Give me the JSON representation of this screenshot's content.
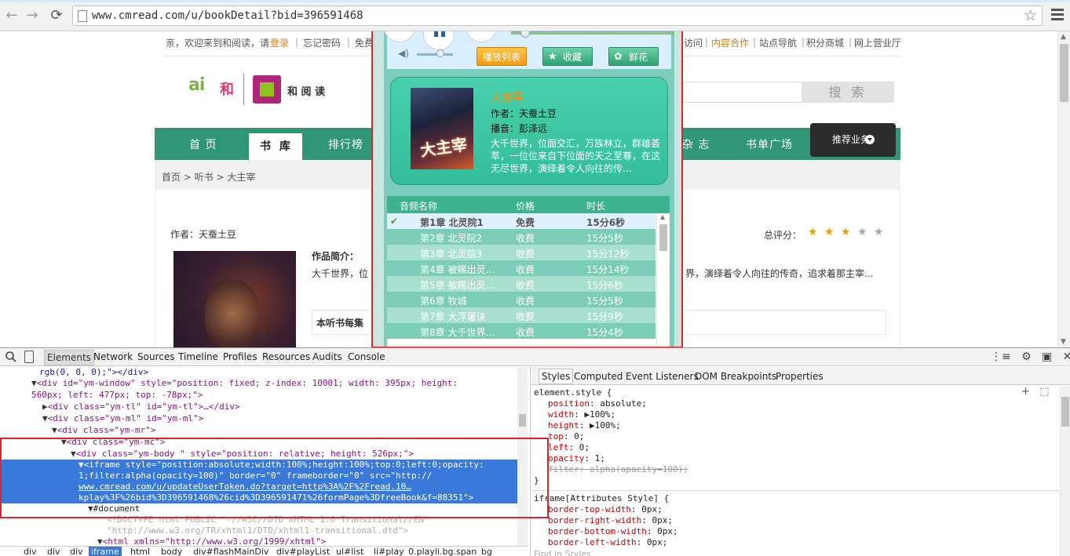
{
  "browser": {
    "url": "www.cmread.com/u/bookDetail?bid=396591468"
  },
  "site": {
    "topbar_links": [
      "亲，欢迎来到和阅读，请",
      "登录",
      "｜",
      "忘记密码",
      "｜",
      "免费",
      "访问",
      "｜",
      "内容合作",
      "｜",
      "站点导航",
      "｜",
      "积分商城",
      "｜",
      "网上营业厅"
    ],
    "logo_ai": "ai",
    "logo_he": "和",
    "logo_text": "和 阅 读",
    "search_label": "搜 索",
    "nav_items": [
      "首 页",
      "书 库",
      "排行榜",
      "杂 志",
      "书单广场"
    ],
    "promo_label": "推荐业务",
    "breadcrumb": "首页 >  听书 >  大主宰",
    "author_line": "作者：天蚕土豆",
    "rating_label": "总评分：",
    "intro_title": "作品简介：",
    "intro_text_left": "大千世界，位",
    "intro_text_right": "界，演绎着令人向往的传奇，追求着那主宰...",
    "chapter_box_label": "本听书每集"
  },
  "player": {
    "playlist_label": "播放列表",
    "favorite_label": "收藏",
    "flower_label": "鲜花",
    "book_title": "大主宰",
    "book_author": "作者：天蚕土豆",
    "book_narrator": "播音：彭泽远",
    "book_desc": "大千世界，位面交汇，万族林立，群雄荟萃，一位位来自下位面的天之至尊，在这无尽世界，演绎着令人向往的传...",
    "cover_title": "大主宰",
    "columns": [
      "音频名称",
      "价格",
      "时长"
    ],
    "rows": [
      {
        "name": "第1章  北灵院1",
        "price": "免费",
        "duration": "15分6秒"
      },
      {
        "name": "第2章  北灵院2",
        "price": "收费",
        "duration": "15分5秒"
      },
      {
        "name": "第3章  北灵院3",
        "price": "收费",
        "duration": "15分12秒"
      },
      {
        "name": "第4章  被赐出灵…",
        "price": "收费",
        "duration": "15分14秒"
      },
      {
        "name": "第5章  被赐出灵…",
        "price": "收费",
        "duration": "15分6秒"
      },
      {
        "name": "第6章  牧城",
        "price": "收费",
        "duration": "15分5秒"
      },
      {
        "name": "第7章  大浮屠诀",
        "price": "收费",
        "duration": "15分9秒"
      },
      {
        "name": "第8章  大千世界…",
        "price": "收费",
        "duration": "15分4秒"
      }
    ]
  },
  "devtools": {
    "tabs": [
      "Elements",
      "Network",
      "Sources",
      "Timeline",
      "Profiles",
      "Resources",
      "Audits",
      "Console"
    ],
    "style_tabs": [
      "Styles",
      "Computed",
      "Event Listeners",
      "DOM Breakpoints",
      "Properties"
    ],
    "breadcrumbs": [
      "div",
      "div",
      "div",
      "iframe",
      "html",
      "body",
      "div#flashMainDiv",
      "div#playList",
      "ul#list",
      "li#play_0.playli.bg.span_bg"
    ],
    "find_placeholder": "Find in Styles",
    "element_style_header": "element.style {",
    "element_style": [
      {
        "prop": "position",
        "value": "absolute;"
      },
      {
        "prop": "width",
        "value": "▶100%;"
      },
      {
        "prop": "height",
        "value": "▶100%;"
      },
      {
        "prop": "top",
        "value": "0;"
      },
      {
        "prop": "left",
        "value": "0;"
      },
      {
        "prop": "opacity",
        "value": "1;"
      },
      {
        "prop": "filter",
        "value": "alpha(opacity=100);"
      }
    ],
    "close_brace": "}",
    "attr_style_header": "iframe[Attributes Style] {",
    "attr_style": [
      {
        "prop": "border-top-width",
        "value": "0px;"
      },
      {
        "prop": "border-right-width",
        "value": "0px;"
      },
      {
        "prop": "border-bottom-width",
        "value": "0px;"
      },
      {
        "prop": "border-left-width",
        "value": "0px;"
      }
    ],
    "dom_lines": [
      "rgb(0, 0, 0);\"></div>",
      "<div id=\"ym-window\" style=\"position: fixed; z-index: 10001; width: 395px; height:",
      "560px; left: 477px; top: -78px;\">",
      "<div class=\"ym-tl\" id=\"ym-tl\">…</div>",
      "<div class=\"ym-ml\" id=\"ym-ml\">",
      "<div class=\"ym-mr\">",
      "<div class=\"ym-mc\">",
      "<div class=\"ym-body \" style=\"position: relative; height: 526px;\">",
      "<iframe style=\"position:absolute;width:100%;height:100%;top:0;left:0;opacity:",
      "1;filter:alpha(opacity=100)\" border=\"0\" frameborder=\"0\" src=\"http://",
      "www.cmread.com/u/updateUserToken.do?target=http%3A%2F%2Fread.10…",
      "kplay%3F%26bid%3D396591468%26cid%3D396591471%26formPage%3DfreeBook&f=88351\">",
      "#document",
      "<!DOCTYPE html PUBLIC \"-//W3C//DTD XHTML 1.0 Transitional//EN\"",
      "\"http://www.w3.org/TR/xhtml1/DTD/xhtml1-transitional.dtd\">",
      "<html xmlns=\"http://www.w3.org/1999/xhtml\">"
    ]
  }
}
